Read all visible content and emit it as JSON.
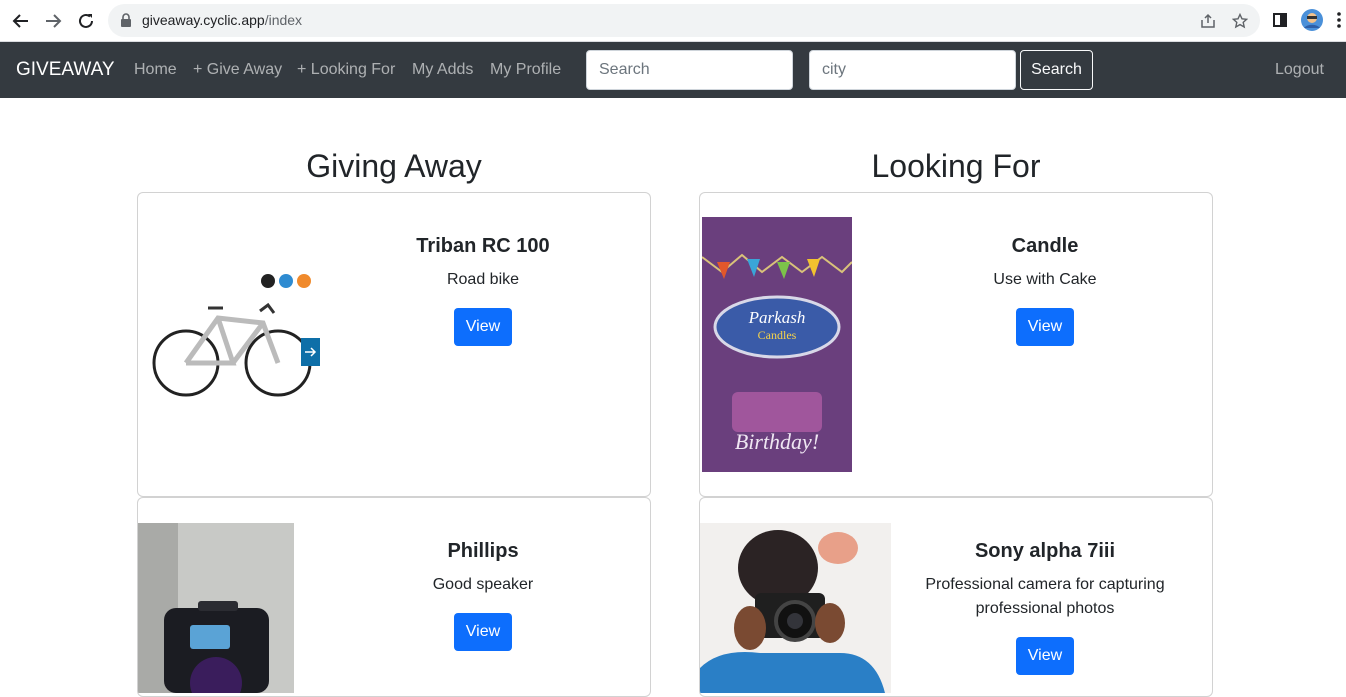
{
  "browser": {
    "url_host": "giveaway.cyclic.app",
    "url_path": "/index"
  },
  "navbar": {
    "brand": "GIVEAWAY",
    "links": [
      "Home",
      "+ Give Away",
      "+ Looking For",
      "My Adds",
      "My Profile"
    ],
    "search_placeholder": "Search",
    "city_placeholder": "city",
    "search_button": "Search",
    "logout": "Logout"
  },
  "giving_away": {
    "heading": "Giving Away",
    "items": [
      {
        "title": "Triban RC 100",
        "description": "Road bike",
        "button": "View"
      },
      {
        "title": "Phillips",
        "description": "Good speaker",
        "button": "View"
      }
    ]
  },
  "looking_for": {
    "heading": "Looking For",
    "items": [
      {
        "title": "Candle",
        "description": "Use with Cake",
        "button": "View",
        "image_text_1": "Parkash",
        "image_text_2": "Candles",
        "image_text_3": "Birthday!"
      },
      {
        "title": "Sony alpha 7iii",
        "description": "Professional camera for capturing professional photos",
        "button": "View"
      }
    ]
  },
  "colors": {
    "navbar_bg": "#343a40",
    "primary": "#0d6efd"
  }
}
